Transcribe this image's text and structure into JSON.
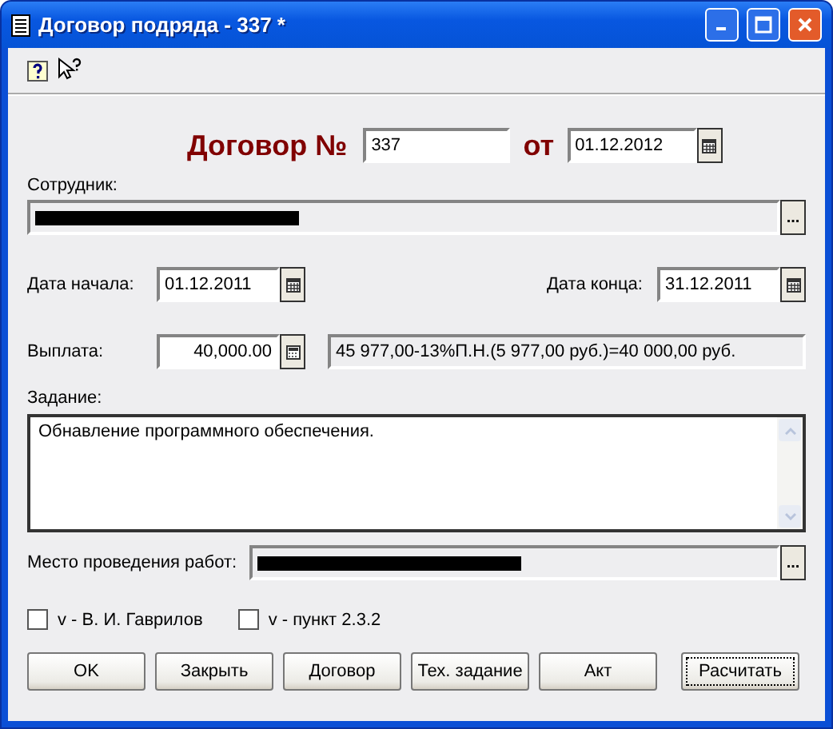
{
  "window": {
    "title": "Договор подряда - 337 *"
  },
  "heading": {
    "label": "Договор №",
    "number": "337",
    "date_label": "от",
    "date": "01.12.2012"
  },
  "employee": {
    "label": "Сотрудник:",
    "redacted": true,
    "browse": "..."
  },
  "start_date": {
    "label": "Дата начала:",
    "value": "01.12.2011"
  },
  "end_date": {
    "label": "Дата конца:",
    "value": "31.12.2011"
  },
  "payment": {
    "label": "Выплата:",
    "value": "40,000.00",
    "calculation": "45 977,00-13%П.Н.(5 977,00 руб.)=40 000,00 руб."
  },
  "task": {
    "label": "Задание:",
    "value": "Обнавление программного обеспечения."
  },
  "place": {
    "label": "Место проведения работ:",
    "redacted": true,
    "browse": "..."
  },
  "checkboxes": [
    {
      "label": "v - В. И. Гаврилов",
      "checked": false
    },
    {
      "label": "v - пункт 2.3.2",
      "checked": false
    }
  ],
  "buttons": [
    {
      "label": "OK",
      "focused": false
    },
    {
      "label": "Закрыть",
      "focused": false
    },
    {
      "label": "Договор",
      "focused": false
    },
    {
      "label": "Тех. задание",
      "focused": false
    },
    {
      "label": "Акт",
      "focused": false
    },
    {
      "label": "Расчитать",
      "focused": true
    }
  ]
}
